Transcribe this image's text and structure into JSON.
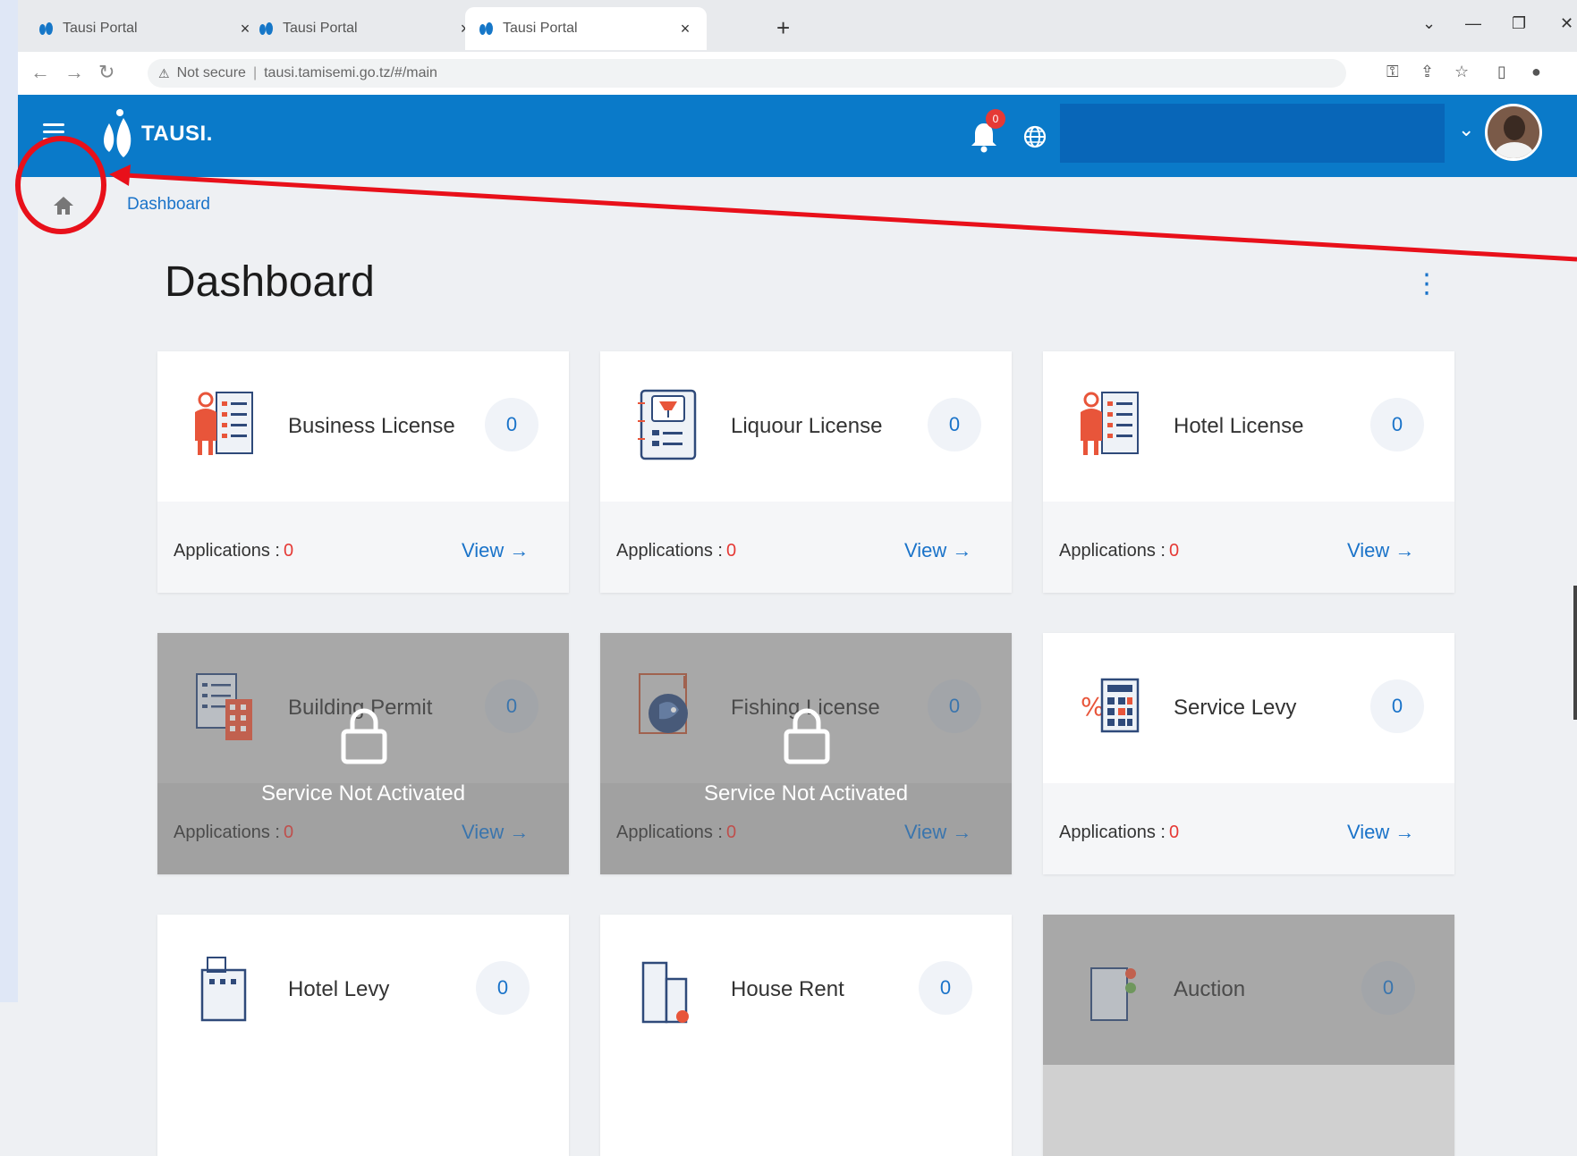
{
  "browser": {
    "tabs": [
      {
        "title": "Tausi Portal"
      },
      {
        "title": "Tausi Portal"
      },
      {
        "title": "Tausi Portal",
        "active": true
      }
    ],
    "new_tab": "+",
    "address": {
      "security": "Not secure",
      "url": "tausi.tamisemi.go.tz/#/main"
    }
  },
  "header": {
    "brand": "TAUSI.",
    "notification_count": "0"
  },
  "breadcrumb": {
    "current": "Dashboard"
  },
  "page": {
    "title": "Dashboard"
  },
  "cards": [
    {
      "title": "Business License",
      "count": "0",
      "apps_label": "Applications :",
      "apps_count": "0",
      "view": "View →",
      "locked": false
    },
    {
      "title": "Liquour License",
      "count": "0",
      "apps_label": "Applications :",
      "apps_count": "0",
      "view": "View →",
      "locked": false
    },
    {
      "title": "Hotel License",
      "count": "0",
      "apps_label": "Applications :",
      "apps_count": "0",
      "view": "View →",
      "locked": false
    },
    {
      "title": "Building Permit",
      "count": "0",
      "apps_label": "Applications :",
      "apps_count": "0",
      "view": "View →",
      "locked": true,
      "lock_text": "Service Not Activated"
    },
    {
      "title": "Fishing License",
      "count": "0",
      "apps_label": "Applications :",
      "apps_count": "0",
      "view": "View →",
      "locked": true,
      "lock_text": "Service Not Activated"
    },
    {
      "title": "Service Levy",
      "count": "0",
      "apps_label": "Applications :",
      "apps_count": "0",
      "view": "View →",
      "locked": false
    },
    {
      "title": "Hotel Levy",
      "count": "0",
      "locked": false
    },
    {
      "title": "House Rent",
      "count": "0",
      "locked": false
    },
    {
      "title": "Auction",
      "count": "0",
      "locked": true
    }
  ],
  "colors": {
    "header_blue": "#0a7ac9",
    "link_blue": "#1a73c9",
    "badge_red": "#e53935",
    "annotation_red": "#e8101a"
  },
  "icons": {
    "menu": "hamburger-icon",
    "bell": "bell-icon",
    "language": "globe-icon",
    "home": "home-icon",
    "lock": "lock-icon"
  }
}
